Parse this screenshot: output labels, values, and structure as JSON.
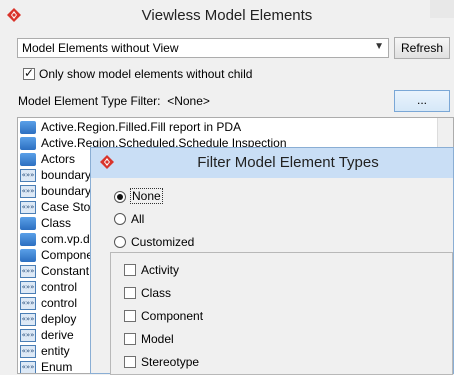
{
  "window": {
    "title": "Viewless Model Elements"
  },
  "view_select": {
    "value": "Model Elements without View"
  },
  "refresh_label": "Refresh",
  "only_without_child": {
    "label": "Only show model elements without child",
    "checked": true
  },
  "type_filter": {
    "label": "Model Element Type Filter:",
    "value": "<None>",
    "button_label": "..."
  },
  "elements": [
    {
      "icon": "activity-icon",
      "label": "Active.Region.Filled.Fill report in PDA"
    },
    {
      "icon": "activity-icon",
      "label": "Active.Region.Scheduled.Schedule Inspection"
    },
    {
      "icon": "actor-icon",
      "label": "Actors"
    },
    {
      "icon": "stereotype-icon",
      "label": "boundary"
    },
    {
      "icon": "stereotype-icon",
      "label": "boundary"
    },
    {
      "icon": "stereotype-icon",
      "label": "Case Story"
    },
    {
      "icon": "class-icon",
      "label": "Class"
    },
    {
      "icon": "class-icon",
      "label": "com.vp.de"
    },
    {
      "icon": "class-icon",
      "label": "Componen"
    },
    {
      "icon": "stereotype-icon",
      "label": "Constant"
    },
    {
      "icon": "stereotype-icon",
      "label": "control"
    },
    {
      "icon": "stereotype-icon",
      "label": "control"
    },
    {
      "icon": "stereotype-icon",
      "label": "deploy"
    },
    {
      "icon": "stereotype-icon",
      "label": "derive"
    },
    {
      "icon": "stereotype-icon",
      "label": "entity"
    },
    {
      "icon": "stereotype-icon",
      "label": "Enum"
    }
  ],
  "dialog": {
    "title": "Filter Model Element Types",
    "options": [
      {
        "label": "None",
        "selected": true
      },
      {
        "label": "All",
        "selected": false
      },
      {
        "label": "Customized",
        "selected": false
      }
    ],
    "types": [
      {
        "label": "Activity",
        "checked": false
      },
      {
        "label": "Class",
        "checked": false
      },
      {
        "label": "Component",
        "checked": false
      },
      {
        "label": "Model",
        "checked": false
      },
      {
        "label": "Stereotype",
        "checked": false
      }
    ]
  },
  "colors": {
    "accent": "#c9def5",
    "logo": "#d9342b"
  }
}
